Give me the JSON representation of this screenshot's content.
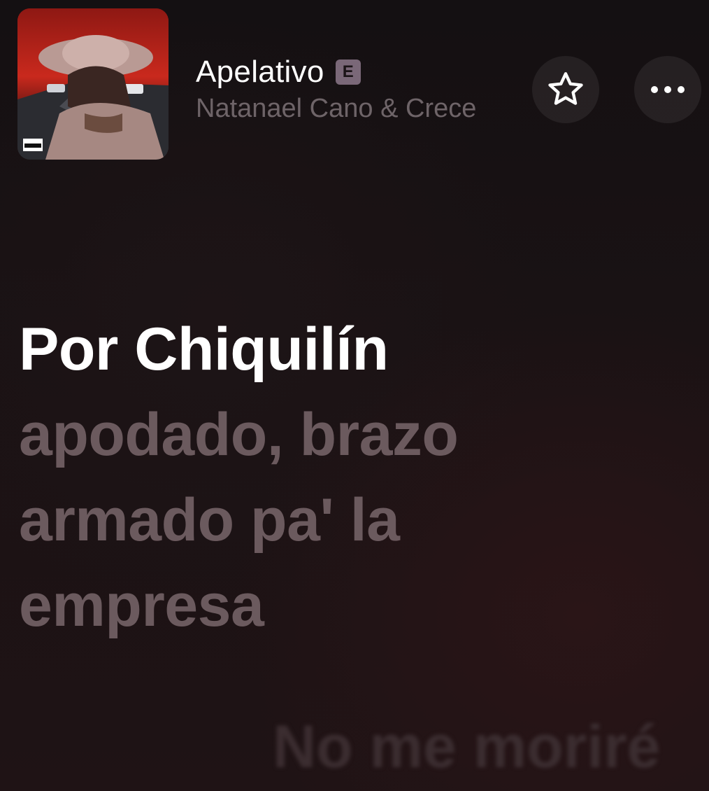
{
  "now_playing": {
    "title": "Apelativo",
    "explicit_badge": "E",
    "artist": "Natanael Cano & Crece",
    "artwork_icon": "album-artwork"
  },
  "actions": {
    "favorite_icon": "star-outline-icon",
    "more_icon": "ellipsis-icon"
  },
  "lyrics": {
    "active_line": "Por Chiquilín",
    "upcoming_line": "apodado, brazo armado pa' la empresa",
    "next_line": "No me moriré"
  },
  "colors": {
    "background": "#161113",
    "active_lyric": "#ffffff",
    "upcoming_lyric": "#6b5a5e",
    "next_lyric": "#3b2d30",
    "badge": "#7a6878"
  }
}
